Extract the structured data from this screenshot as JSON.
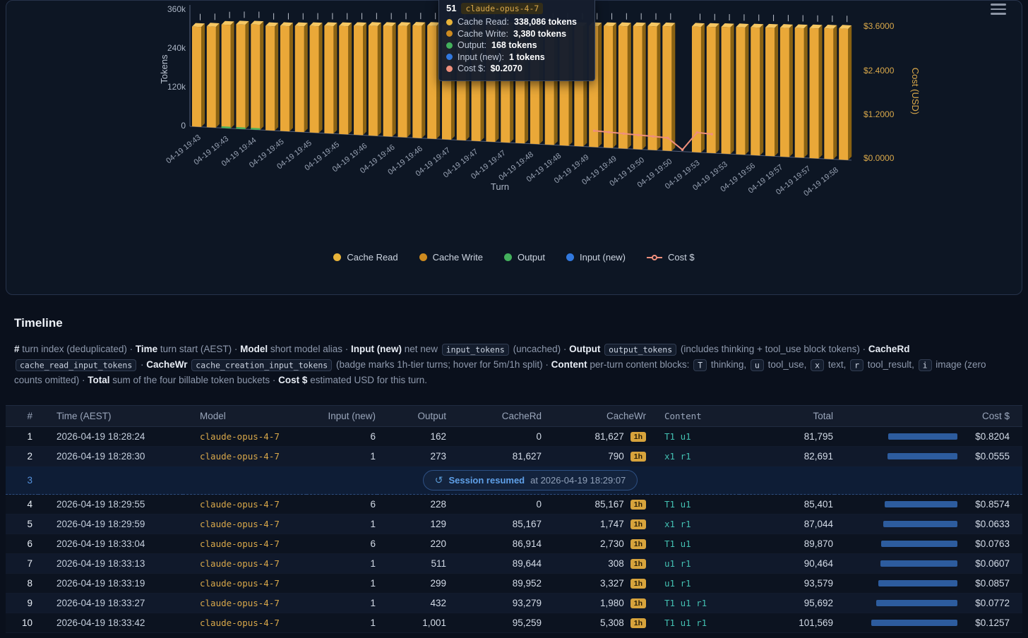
{
  "chart": {
    "tooltip": {
      "turn": "51",
      "model": "claude-opus-4-7",
      "rows": [
        {
          "label": "Cache Read:",
          "value": "338,086 tokens",
          "color": "#e8b339"
        },
        {
          "label": "Cache Write:",
          "value": "3,380 tokens",
          "color": "#cd8a1f"
        },
        {
          "label": "Output:",
          "value": "168 tokens",
          "color": "#43b05c"
        },
        {
          "label": "Input (new):",
          "value": "1 tokens",
          "color": "#3178de"
        },
        {
          "label": "Cost $:",
          "value": "$0.2070",
          "color": "#ef8f7c"
        }
      ]
    }
  },
  "chart_data": {
    "type": "bar",
    "title": "",
    "xlabel": "Turn",
    "ylabel": "Tokens",
    "y2label": "Cost (USD)",
    "ylim": [
      0,
      360000
    ],
    "y2lim": [
      0,
      3.6
    ],
    "y_ticks": [
      "360k",
      "240k",
      "120k",
      "0"
    ],
    "y2_ticks": [
      "$3.6000",
      "$2.4000",
      "$1.2000",
      "$0.0000"
    ],
    "x_tick_labels": [
      "04-19 19:43",
      "04-19 19:43",
      "04-19 19:44",
      "04-19 19:45",
      "04-19 19:45",
      "04-19 19:45",
      "04-19 19:46",
      "04-19 19:46",
      "04-19 19:46",
      "04-19 19:47",
      "04-19 19:47",
      "04-19 19:47",
      "04-19 19:48",
      "04-19 19:48",
      "04-19 19:49",
      "04-19 19:49",
      "04-19 19:50",
      "04-19 19:50",
      "04-19 19:53",
      "04-19 19:53",
      "04-19 19:56",
      "04-19 19:57",
      "04-19 19:57",
      "04-19 19:58"
    ],
    "slots": 45,
    "bar_colors": {
      "front": "#eaa838",
      "top": "#f6c763",
      "side": "#8a6212"
    },
    "series": [
      {
        "name": "Cache Read",
        "color": "#e8b339",
        "marker": "dot",
        "values": [
          303000,
          305000,
          307000,
          309000,
          310000,
          311500,
          313000,
          314000,
          315500,
          317000,
          318000,
          319500,
          321000,
          322000,
          323500,
          325000,
          326000,
          327500,
          329000,
          330000,
          331000,
          332000,
          333000,
          334000,
          335000,
          336000,
          337000,
          338086,
          339000,
          340000,
          341000,
          342000,
          343000,
          null,
          344000,
          344500,
          345000,
          345500,
          346000,
          346500,
          347000,
          347500,
          348000,
          348500,
          349000
        ]
      },
      {
        "name": "Cache Write",
        "color": "#cd8a1f",
        "marker": "dot",
        "values": [
          3380,
          3380,
          3380,
          3380,
          3380,
          3380,
          3380,
          3380,
          3380,
          3380,
          3380,
          3380,
          3380,
          3380,
          3380,
          3380,
          3380,
          3380,
          3380,
          3380,
          3380,
          3380,
          3380,
          3380,
          3380,
          3380,
          3380,
          3380,
          3380,
          3380,
          3380,
          3380,
          3380,
          null,
          3380,
          3380,
          3380,
          3380,
          3380,
          3380,
          3380,
          3380,
          3380,
          3380,
          3380
        ]
      },
      {
        "name": "Output",
        "color": "#43b05c",
        "marker": "dot",
        "values": [
          168,
          168,
          5000,
          5000,
          5000,
          168,
          168,
          168,
          168,
          168,
          168,
          168,
          168,
          168,
          168,
          168,
          168,
          168,
          168,
          168,
          168,
          168,
          168,
          168,
          168,
          168,
          168,
          168,
          168,
          168,
          168,
          168,
          168,
          null,
          168,
          168,
          168,
          168,
          168,
          168,
          168,
          168,
          168,
          168,
          168
        ]
      },
      {
        "name": "Input (new)",
        "color": "#3178de",
        "marker": "dot",
        "values": [
          1,
          1,
          1,
          1,
          1,
          1,
          1,
          1,
          1,
          1,
          1,
          1,
          1,
          1,
          1,
          1,
          1,
          1,
          1,
          1,
          1,
          1,
          1,
          1,
          1,
          1,
          1,
          1,
          1,
          1,
          1,
          1,
          1,
          null,
          1,
          1,
          1,
          1,
          1,
          1,
          1,
          1,
          1,
          1,
          1
        ]
      },
      {
        "name": "Cost $",
        "color": "#ef8f7c",
        "marker": "line",
        "axis": "y2",
        "type": "line",
        "values": [
          null,
          null,
          null,
          null,
          null,
          null,
          null,
          null,
          null,
          null,
          null,
          null,
          null,
          null,
          null,
          null,
          null,
          null,
          null,
          null,
          null,
          null,
          null,
          null,
          null,
          null,
          null,
          0.46,
          0.44,
          0.42,
          0.4,
          0.38,
          0.36,
          0.05,
          0.55,
          0.52,
          null,
          null,
          null,
          null,
          null,
          null,
          null,
          null,
          null
        ]
      }
    ]
  },
  "timeline": {
    "heading": "Timeline",
    "description_segments": [
      {
        "t": "# ",
        "s": "bold"
      },
      {
        "t": "turn index (deduplicated) · ",
        "s": "normal"
      },
      {
        "t": "Time",
        "s": "bold"
      },
      {
        "t": " turn start (AEST) · ",
        "s": "normal"
      },
      {
        "t": "Model",
        "s": "bold"
      },
      {
        "t": " short model alias · ",
        "s": "normal"
      },
      {
        "t": "Input (new)",
        "s": "bold"
      },
      {
        "t": " net new ",
        "s": "normal"
      },
      {
        "t": "input_tokens",
        "s": "code"
      },
      {
        "t": " (uncached) · ",
        "s": "normal"
      },
      {
        "t": "Output",
        "s": "bold"
      },
      {
        "t": " ",
        "s": "normal"
      },
      {
        "t": "output_tokens",
        "s": "code"
      },
      {
        "t": " (includes thinking + tool_use block tokens) · ",
        "s": "normal"
      },
      {
        "t": "CacheRd",
        "s": "bold"
      },
      {
        "t": " ",
        "s": "normal"
      },
      {
        "t": "cache_read_input_tokens",
        "s": "code"
      },
      {
        "t": " · ",
        "s": "normal"
      },
      {
        "t": "CacheWr",
        "s": "bold"
      },
      {
        "t": " ",
        "s": "normal"
      },
      {
        "t": "cache_creation_input_tokens",
        "s": "code"
      },
      {
        "t": " (badge marks 1h-tier turns; hover for 5m/1h split) · ",
        "s": "normal"
      },
      {
        "t": "Content",
        "s": "bold"
      },
      {
        "t": " per-turn content blocks: ",
        "s": "normal"
      },
      {
        "t": "T",
        "s": "code"
      },
      {
        "t": " thinking, ",
        "s": "normal"
      },
      {
        "t": "u",
        "s": "code"
      },
      {
        "t": " tool_use, ",
        "s": "normal"
      },
      {
        "t": "x",
        "s": "code"
      },
      {
        "t": " text, ",
        "s": "normal"
      },
      {
        "t": "r",
        "s": "code"
      },
      {
        "t": " tool_result, ",
        "s": "normal"
      },
      {
        "t": "i",
        "s": "code"
      },
      {
        "t": " image (zero counts omitted) · ",
        "s": "normal"
      },
      {
        "t": "Total",
        "s": "bold"
      },
      {
        "t": " sum of the four billable token buckets · ",
        "s": "normal"
      },
      {
        "t": "Cost $",
        "s": "bold"
      },
      {
        "t": " estimated USD for this turn.",
        "s": "normal"
      }
    ]
  },
  "table": {
    "columns": [
      {
        "key": "idx",
        "label": "#",
        "align": "right"
      },
      {
        "key": "time",
        "label": "Time (AEST)",
        "align": "left"
      },
      {
        "key": "model",
        "label": "Model",
        "align": "left"
      },
      {
        "key": "input",
        "label": "Input (new)",
        "align": "right"
      },
      {
        "key": "output",
        "label": "Output",
        "align": "right"
      },
      {
        "key": "cacherd",
        "label": "CacheRd",
        "align": "right"
      },
      {
        "key": "cachewr",
        "label": "CacheWr",
        "align": "right"
      },
      {
        "key": "content",
        "label": "Content",
        "align": "left",
        "mono": true
      },
      {
        "key": "total",
        "label": "Total",
        "align": "right"
      },
      {
        "key": "cost",
        "label": "Cost $",
        "align": "right"
      }
    ],
    "rows": [
      {
        "type": "turn",
        "idx": "1",
        "time": "2026-04-19 18:28:24",
        "model": "claude-opus-4-7",
        "input": "6",
        "output": "162",
        "cacherd": "0",
        "cachewr": "81,627",
        "badge": "1h",
        "content": "T1 u1",
        "total": "81,795",
        "cost": "$0.8204"
      },
      {
        "type": "turn",
        "idx": "2",
        "time": "2026-04-19 18:28:30",
        "model": "claude-opus-4-7",
        "input": "1",
        "output": "273",
        "cacherd": "81,627",
        "cachewr": "790",
        "badge": "1h",
        "content": "x1 r1",
        "total": "82,691",
        "cost": "$0.0555"
      },
      {
        "type": "session",
        "idx": "3",
        "icon": "↺",
        "label": "Session resumed",
        "detail": "at 2026-04-19 18:29:07"
      },
      {
        "type": "turn",
        "idx": "4",
        "time": "2026-04-19 18:29:55",
        "model": "claude-opus-4-7",
        "input": "6",
        "output": "228",
        "cacherd": "0",
        "cachewr": "85,167",
        "badge": "1h",
        "content": "T1 u1",
        "total": "85,401",
        "cost": "$0.8574"
      },
      {
        "type": "turn",
        "idx": "5",
        "time": "2026-04-19 18:29:59",
        "model": "claude-opus-4-7",
        "input": "1",
        "output": "129",
        "cacherd": "85,167",
        "cachewr": "1,747",
        "badge": "1h",
        "content": "x1 r1",
        "total": "87,044",
        "cost": "$0.0633"
      },
      {
        "type": "turn",
        "idx": "6",
        "time": "2026-04-19 18:33:04",
        "model": "claude-opus-4-7",
        "input": "6",
        "output": "220",
        "cacherd": "86,914",
        "cachewr": "2,730",
        "badge": "1h",
        "content": "T1 u1",
        "total": "89,870",
        "cost": "$0.0763"
      },
      {
        "type": "turn",
        "idx": "7",
        "time": "2026-04-19 18:33:13",
        "model": "claude-opus-4-7",
        "input": "1",
        "output": "511",
        "cacherd": "89,644",
        "cachewr": "308",
        "badge": "1h",
        "content": "u1 r1",
        "total": "90,464",
        "cost": "$0.0607"
      },
      {
        "type": "turn",
        "idx": "8",
        "time": "2026-04-19 18:33:19",
        "model": "claude-opus-4-7",
        "input": "1",
        "output": "299",
        "cacherd": "89,952",
        "cachewr": "3,327",
        "badge": "1h",
        "content": "u1 r1",
        "total": "93,579",
        "cost": "$0.0857"
      },
      {
        "type": "turn",
        "idx": "9",
        "time": "2026-04-19 18:33:27",
        "model": "claude-opus-4-7",
        "input": "1",
        "output": "432",
        "cacherd": "93,279",
        "cachewr": "1,980",
        "badge": "1h",
        "content": "T1 u1 r1",
        "total": "95,692",
        "cost": "$0.0772"
      },
      {
        "type": "turn",
        "idx": "10",
        "time": "2026-04-19 18:33:42",
        "model": "claude-opus-4-7",
        "input": "1",
        "output": "1,001",
        "cacherd": "95,259",
        "cachewr": "5,308",
        "badge": "1h",
        "content": "T1 u1 r1",
        "total": "101,569",
        "cost": "$0.1257"
      }
    ]
  }
}
